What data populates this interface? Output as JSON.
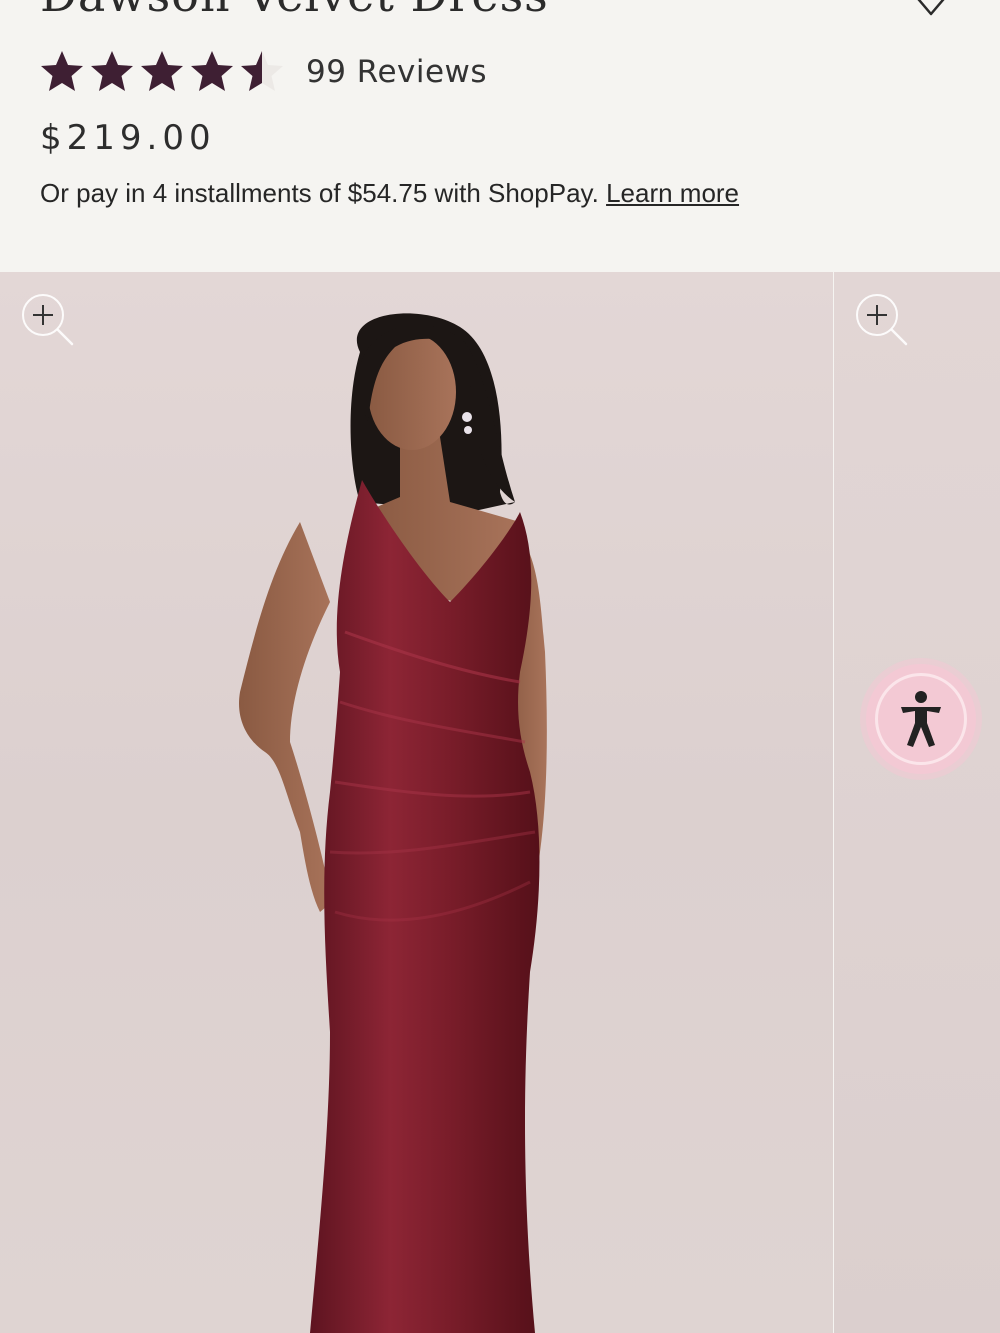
{
  "product": {
    "title": "Dawson Velvet Dress",
    "rating": 4.5,
    "rating_max": 5,
    "reviews_label": "99 Reviews",
    "price": "$219.00",
    "installments_text": "Or pay in 4 installments of $54.75 with ShopPay.",
    "learn_more_label": "Learn more"
  },
  "colors": {
    "star": "#3e1f33",
    "dress": "#7a1d2a",
    "accessibility_button": "#f3c9d4"
  },
  "icons": {
    "wishlist": "heart-outline-icon",
    "zoom": "zoom-in-icon",
    "accessibility": "accessibility-person-icon",
    "star": "star-icon"
  },
  "gallery": {
    "slide_count_visible": 2
  }
}
